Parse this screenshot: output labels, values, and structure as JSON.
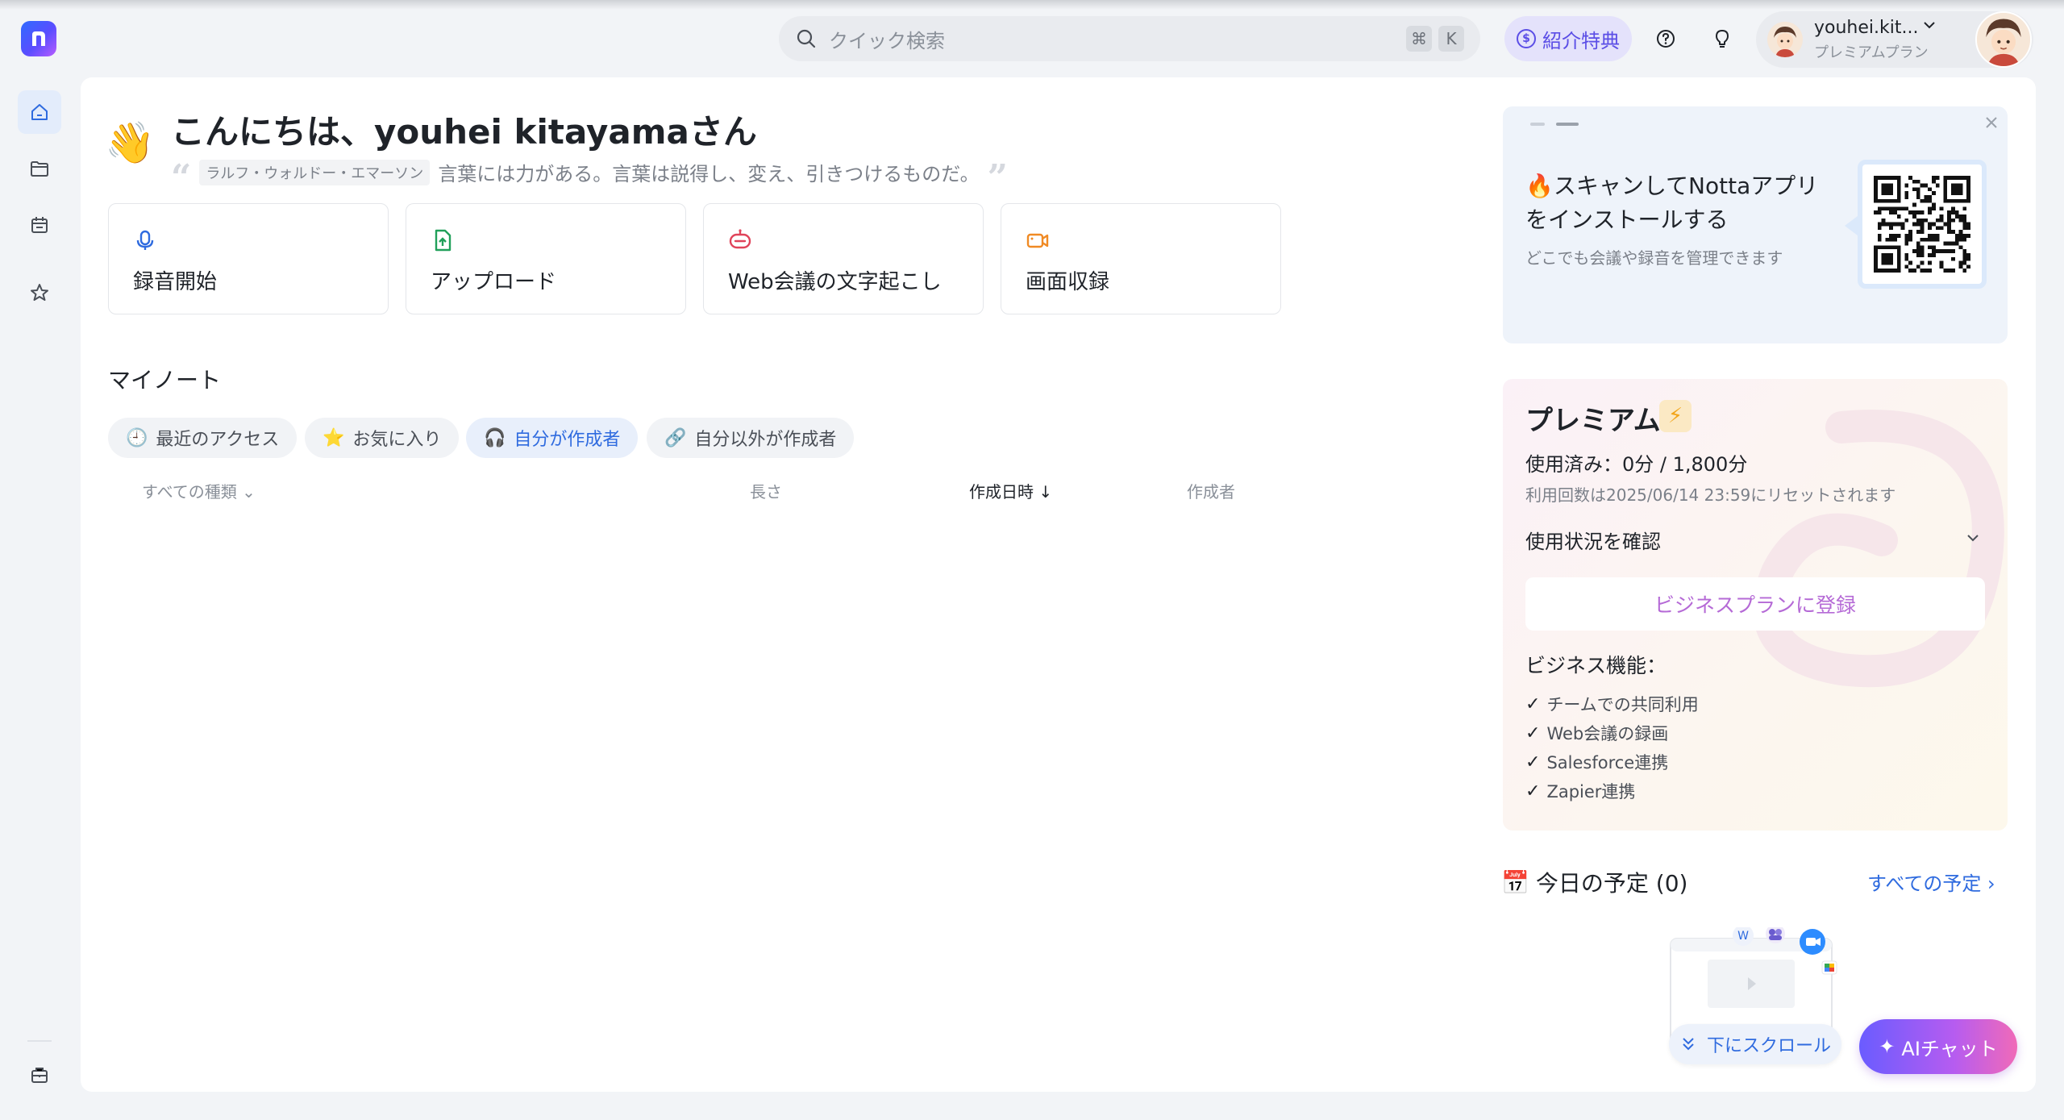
{
  "app": {
    "brand_letter": "n"
  },
  "search": {
    "placeholder": "クイック検索",
    "shortcut_cmd": "⌘",
    "shortcut_key": "K"
  },
  "header": {
    "referral_label": "紹介特典",
    "account_name": "youhei.kit...",
    "account_plan": "プレミアムプラン"
  },
  "greeting": {
    "title": "こんにちは、youhei kitayamaさん",
    "quote_author": "ラルフ・ウォルドー・エマーソン",
    "quote_text": "言葉には力がある。言葉は説得し、変え、引きつけるものだ。"
  },
  "actions": [
    {
      "label": "録音開始",
      "icon": "microphone-icon",
      "color": "#2f6bdf"
    },
    {
      "label": "アップロード",
      "icon": "upload-file-icon",
      "color": "#21a05a"
    },
    {
      "label": "Web会議の文字起こし",
      "icon": "meeting-bot-icon",
      "color": "#e0445a"
    },
    {
      "label": "画面収録",
      "icon": "video-camera-icon",
      "color": "#f08a24"
    }
  ],
  "notes": {
    "title": "マイノート",
    "filters": [
      {
        "label": "最近のアクセス",
        "icon": "clock-icon",
        "active": false
      },
      {
        "label": "お気に入り",
        "icon": "star-icon",
        "active": false
      },
      {
        "label": "自分が作成者",
        "icon": "headphones-icon",
        "active": true
      },
      {
        "label": "自分以外が作成者",
        "icon": "link-icon",
        "active": false
      }
    ],
    "columns": {
      "type": "すべての種類",
      "length": "長さ",
      "created": "作成日時",
      "creator": "作成者"
    },
    "sort_arrow": "↓"
  },
  "qr_card": {
    "title": "スキャンしてNottaアプリをインストールする",
    "subtitle": "どこでも会議や録音を管理できます"
  },
  "premium": {
    "title": "プレミアム",
    "usage": "使用済み：0分 / 1,800分",
    "reset": "利用回数は2025/06/14 23:59にリセットされます",
    "usage_check": "使用状況を確認",
    "business_button": "ビジネスプランに登録",
    "business_title": "ビジネス機能：",
    "features": [
      "チームでの共同利用",
      "Web会議の録画",
      "Salesforce連携",
      "Zapier連携"
    ]
  },
  "schedule": {
    "title": "今日の予定 (0)",
    "link": "すべての予定"
  },
  "floating": {
    "scroll_label": "下にスクロール",
    "ai_chat_label": "AIチャット"
  },
  "colors": {
    "accent": "#2f6bdf",
    "referral": "#5b4ee6",
    "business_button_text": "#b56ad6"
  }
}
